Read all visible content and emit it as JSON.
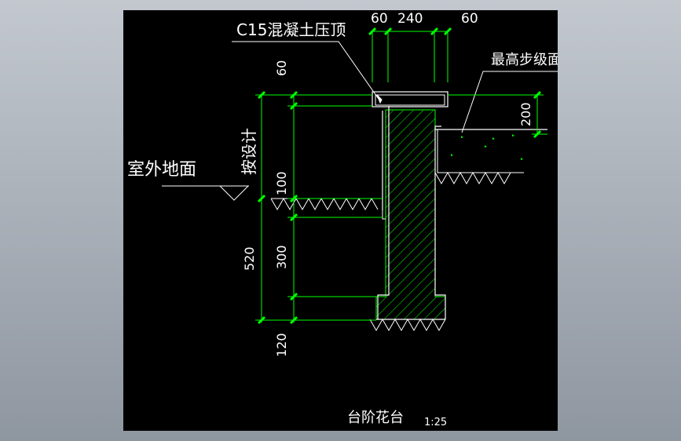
{
  "labels": {
    "cap_note": "C15混凝土压顶",
    "top_step": "最高步级面",
    "outdoor_ground": "室外地面",
    "as_designed": "按设计",
    "title": "台阶花台",
    "scale": "1:25"
  },
  "dimensions": {
    "top_left": "60",
    "top_mid": "240",
    "top_right": "60",
    "left_60": "60",
    "left_100": "100",
    "left_520": "520",
    "left_300": "300",
    "left_120": "120",
    "right_200": "200"
  },
  "colors": {
    "background": "#000000",
    "dim_line": "#00ff00",
    "tick": "#00ff00",
    "outline": "#ffffff",
    "hatch": "#00ff00"
  }
}
